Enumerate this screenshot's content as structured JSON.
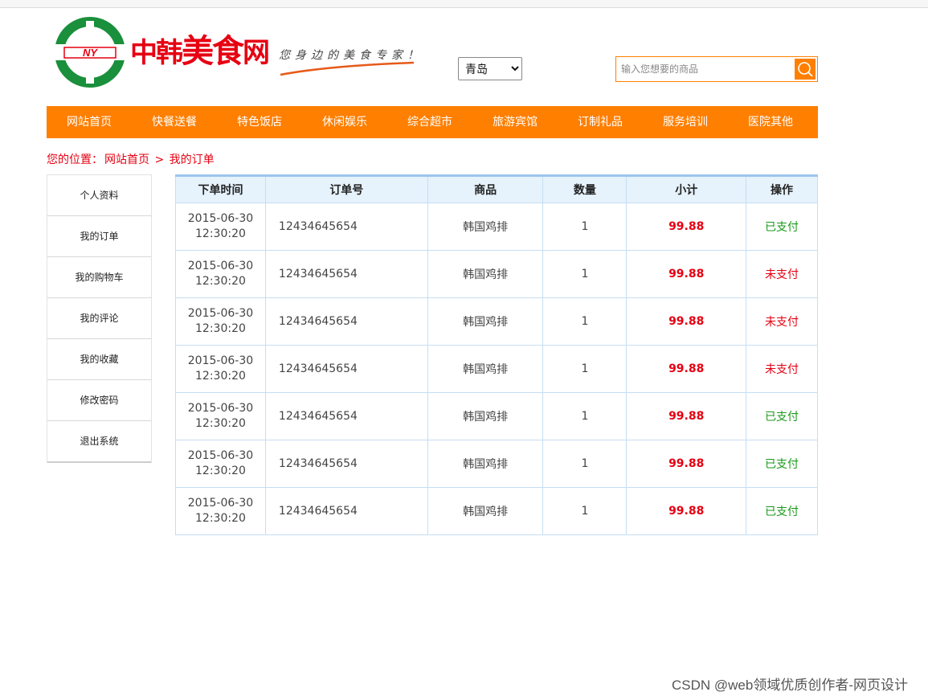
{
  "brand": {
    "logo_letters": "NY",
    "name_part1": "中韩",
    "name_part2": "美食",
    "name_part3": "网",
    "slogan": "您身边的美食专家！"
  },
  "city_select": {
    "selected": "青岛"
  },
  "search": {
    "placeholder": "输入您想要的商品",
    "value": ""
  },
  "nav": {
    "items": [
      "网站首页",
      "快餐送餐",
      "特色饭店",
      "休闲娱乐",
      "综合超市",
      "旅游宾馆",
      "订制礼品",
      "服务培训",
      "医院其他"
    ]
  },
  "breadcrumb": {
    "prefix": "您的位置：",
    "home": "网站首页",
    "sep": ">",
    "current": "我的订单"
  },
  "sidebar": {
    "items": [
      "个人资料",
      "我的订单",
      "我的购物车",
      "我的评论",
      "我的收藏",
      "修改密码",
      "退出系统"
    ]
  },
  "orders": {
    "headers": [
      "下单时间",
      "订单号",
      "商品",
      "数量",
      "小计",
      "操作"
    ],
    "rows": [
      {
        "date": "2015-06-30",
        "time": "12:30:20",
        "order_no": "12434645654",
        "goods": "韩国鸡排",
        "qty": "1",
        "subtotal": "99.88",
        "status": "已支付",
        "paid": true
      },
      {
        "date": "2015-06-30",
        "time": "12:30:20",
        "order_no": "12434645654",
        "goods": "韩国鸡排",
        "qty": "1",
        "subtotal": "99.88",
        "status": "未支付",
        "paid": false
      },
      {
        "date": "2015-06-30",
        "time": "12:30:20",
        "order_no": "12434645654",
        "goods": "韩国鸡排",
        "qty": "1",
        "subtotal": "99.88",
        "status": "未支付",
        "paid": false
      },
      {
        "date": "2015-06-30",
        "time": "12:30:20",
        "order_no": "12434645654",
        "goods": "韩国鸡排",
        "qty": "1",
        "subtotal": "99.88",
        "status": "未支付",
        "paid": false
      },
      {
        "date": "2015-06-30",
        "time": "12:30:20",
        "order_no": "12434645654",
        "goods": "韩国鸡排",
        "qty": "1",
        "subtotal": "99.88",
        "status": "已支付",
        "paid": true
      },
      {
        "date": "2015-06-30",
        "time": "12:30:20",
        "order_no": "12434645654",
        "goods": "韩国鸡排",
        "qty": "1",
        "subtotal": "99.88",
        "status": "已支付",
        "paid": true
      },
      {
        "date": "2015-06-30",
        "time": "12:30:20",
        "order_no": "12434645654",
        "goods": "韩国鸡排",
        "qty": "1",
        "subtotal": "99.88",
        "status": "已支付",
        "paid": true
      }
    ]
  },
  "watermark": "CSDN @web领域优质创作者-网页设计",
  "colors": {
    "accent": "#ff7f00",
    "brand_red": "#e60012",
    "logo_green": "#1a8f3c",
    "paid_green": "#1a9a1a",
    "table_header": "#e6f2fc"
  },
  "icons": {
    "logo": "ny-circle-logo",
    "search": "search-icon"
  }
}
